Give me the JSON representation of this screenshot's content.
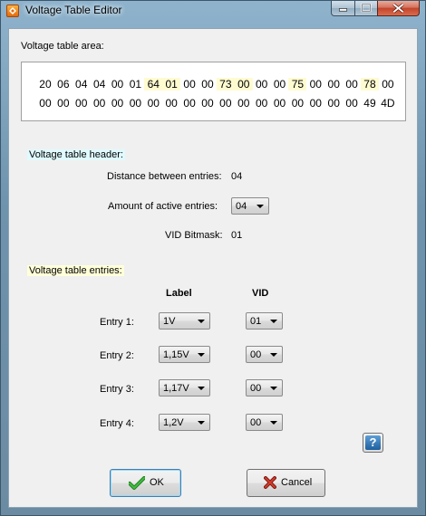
{
  "window": {
    "title": "Voltage Table Editor",
    "icon": "diamond-app-icon"
  },
  "area": {
    "label": "Voltage table area:",
    "row1": [
      {
        "b": "20",
        "hl": false
      },
      {
        "b": "06",
        "hl": false
      },
      {
        "b": "04",
        "hl": false
      },
      {
        "b": "04",
        "hl": false
      },
      {
        "b": "00",
        "hl": false
      },
      {
        "b": "01",
        "hl": false
      },
      {
        "b": "64",
        "hl": true
      },
      {
        "b": "01",
        "hl": true
      },
      {
        "b": "00",
        "hl": false
      },
      {
        "b": "00",
        "hl": false
      },
      {
        "b": "73",
        "hl": true
      },
      {
        "b": "00",
        "hl": true
      },
      {
        "b": "00",
        "hl": false
      },
      {
        "b": "00",
        "hl": false
      },
      {
        "b": "75",
        "hl": true
      },
      {
        "b": "00",
        "hl": false
      },
      {
        "b": "00",
        "hl": false
      },
      {
        "b": "00",
        "hl": false
      },
      {
        "b": "78",
        "hl": true
      },
      {
        "b": "00",
        "hl": false
      }
    ],
    "row2": [
      {
        "b": "00",
        "hl": false
      },
      {
        "b": "00",
        "hl": false
      },
      {
        "b": "00",
        "hl": false
      },
      {
        "b": "00",
        "hl": false
      },
      {
        "b": "00",
        "hl": false
      },
      {
        "b": "00",
        "hl": false
      },
      {
        "b": "00",
        "hl": false
      },
      {
        "b": "00",
        "hl": false
      },
      {
        "b": "00",
        "hl": false
      },
      {
        "b": "00",
        "hl": false
      },
      {
        "b": "00",
        "hl": false
      },
      {
        "b": "00",
        "hl": false
      },
      {
        "b": "00",
        "hl": false
      },
      {
        "b": "00",
        "hl": false
      },
      {
        "b": "00",
        "hl": false
      },
      {
        "b": "00",
        "hl": false
      },
      {
        "b": "00",
        "hl": false
      },
      {
        "b": "00",
        "hl": false
      },
      {
        "b": "49",
        "hl": false
      },
      {
        "b": "4D",
        "hl": false
      }
    ]
  },
  "header": {
    "title": "Voltage table header:",
    "distance_label": "Distance between entries:",
    "distance_value": "04",
    "active_label": "Amount of active entries:",
    "active_value": "04",
    "vid_bitmask_label": "VID Bitmask:",
    "vid_bitmask_value": "01"
  },
  "entries": {
    "title": "Voltage table entries:",
    "col_label": "Label",
    "col_vid": "VID",
    "rows": [
      {
        "name": "Entry 1:",
        "label": "1V",
        "vid": "01"
      },
      {
        "name": "Entry 2:",
        "label": "1,15V",
        "vid": "00"
      },
      {
        "name": "Entry 3:",
        "label": "1,17V",
        "vid": "00"
      },
      {
        "name": "Entry 4:",
        "label": "1,2V",
        "vid": "00"
      }
    ]
  },
  "buttons": {
    "help": "?",
    "ok": "OK",
    "cancel": "Cancel"
  },
  "colors": {
    "highlight_bytes": "#fffbd0",
    "header_title_bg": "#e0faff",
    "entries_title_bg": "#ffffd9",
    "ok_icon": "#2a9d2a",
    "cancel_icon": "#b0271b"
  }
}
